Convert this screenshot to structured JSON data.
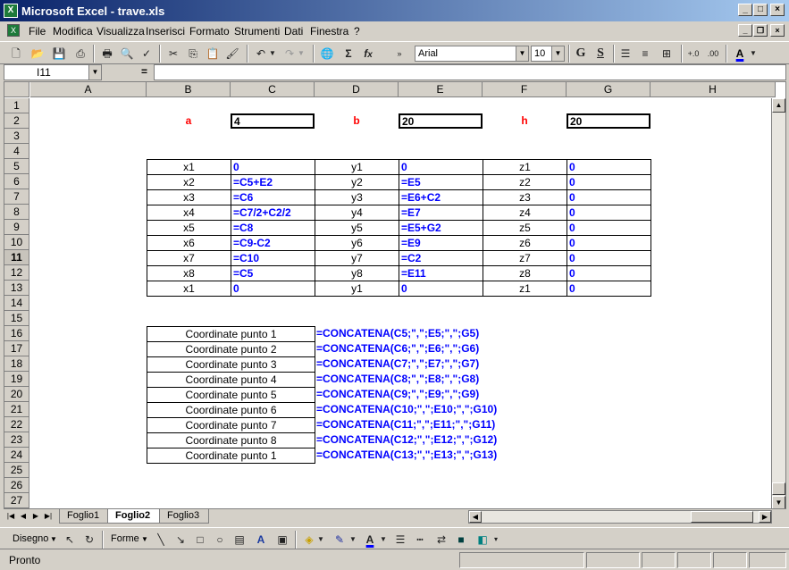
{
  "window": {
    "title": "Microsoft Excel - trave.xls",
    "app_icon": "excel-icon"
  },
  "menu": [
    "File",
    "Modifica",
    "Visualizza",
    "Inserisci",
    "Formato",
    "Strumenti",
    "Dati",
    "Finestra",
    "?"
  ],
  "toolbar": {
    "font": "Arial",
    "size": "10",
    "bold": "G",
    "underline": "S"
  },
  "formula_bar": {
    "name_box": "I11",
    "equals": "="
  },
  "columns": [
    "A",
    "B",
    "C",
    "D",
    "E",
    "F",
    "G",
    "H"
  ],
  "rows": [
    "1",
    "2",
    "3",
    "4",
    "5",
    "6",
    "7",
    "8",
    "9",
    "10",
    "11",
    "12",
    "13",
    "14",
    "15",
    "16",
    "17",
    "18",
    "19",
    "20",
    "21",
    "22",
    "23",
    "24",
    "25",
    "26",
    "27"
  ],
  "params": [
    {
      "label": "a",
      "value": "4"
    },
    {
      "label": "b",
      "value": "20"
    },
    {
      "label": "h",
      "value": "20"
    }
  ],
  "table": [
    {
      "x": "x1",
      "xv": "0",
      "y": "y1",
      "yv": "0",
      "z": "z1",
      "zv": "0"
    },
    {
      "x": "x2",
      "xv": "=C5+E2",
      "y": "y2",
      "yv": "=E5",
      "z": "z2",
      "zv": "0"
    },
    {
      "x": "x3",
      "xv": "=C6",
      "y": "y3",
      "yv": "=E6+C2",
      "z": "z3",
      "zv": "0"
    },
    {
      "x": "x4",
      "xv": "=C7/2+C2/2",
      "y": "y4",
      "yv": "=E7",
      "z": "z4",
      "zv": "0"
    },
    {
      "x": "x5",
      "xv": "=C8",
      "y": "y5",
      "yv": "=E5+G2",
      "z": "z5",
      "zv": "0"
    },
    {
      "x": "x6",
      "xv": "=C9-C2",
      "y": "y6",
      "yv": "=E9",
      "z": "z6",
      "zv": "0"
    },
    {
      "x": "x7",
      "xv": "=C10",
      "y": "y7",
      "yv": "=C2",
      "z": "z7",
      "zv": "0"
    },
    {
      "x": "x8",
      "xv": "=C5",
      "y": "y8",
      "yv": "=E11",
      "z": "z8",
      "zv": "0"
    },
    {
      "x": "x1",
      "xv": "0",
      "y": "y1",
      "yv": "0",
      "z": "z1",
      "zv": "0"
    }
  ],
  "coords": [
    {
      "label": "Coordinate punto 1",
      "formula": "=CONCATENA(C5;\",\";E5;\",\";G5)"
    },
    {
      "label": "Coordinate punto 2",
      "formula": "=CONCATENA(C6;\",\";E6;\",\";G6)"
    },
    {
      "label": "Coordinate punto 3",
      "formula": "=CONCATENA(C7;\",\";E7;\",\";G7)"
    },
    {
      "label": "Coordinate punto 4",
      "formula": "=CONCATENA(C8;\",\";E8;\",\";G8)"
    },
    {
      "label": "Coordinate punto 5",
      "formula": "=CONCATENA(C9;\",\";E9;\",\";G9)"
    },
    {
      "label": "Coordinate punto 6",
      "formula": "=CONCATENA(C10;\",\";E10;\",\";G10)"
    },
    {
      "label": "Coordinate punto 7",
      "formula": "=CONCATENA(C11;\",\";E11;\",\";G11)"
    },
    {
      "label": "Coordinate punto 8",
      "formula": "=CONCATENA(C12;\",\";E12;\",\";G12)"
    },
    {
      "label": "Coordinate punto 1",
      "formula": "=CONCATENA(C13;\",\";E13;\",\";G13)"
    }
  ],
  "tabs": [
    "Foglio1",
    "Foglio2",
    "Foglio3"
  ],
  "active_tab": "Foglio2",
  "drawing": {
    "draw": "Disegno",
    "shapes": "Forme"
  },
  "status": "Pronto",
  "colors": {
    "formula": "#0000ff",
    "param_label": "#ff0000"
  }
}
